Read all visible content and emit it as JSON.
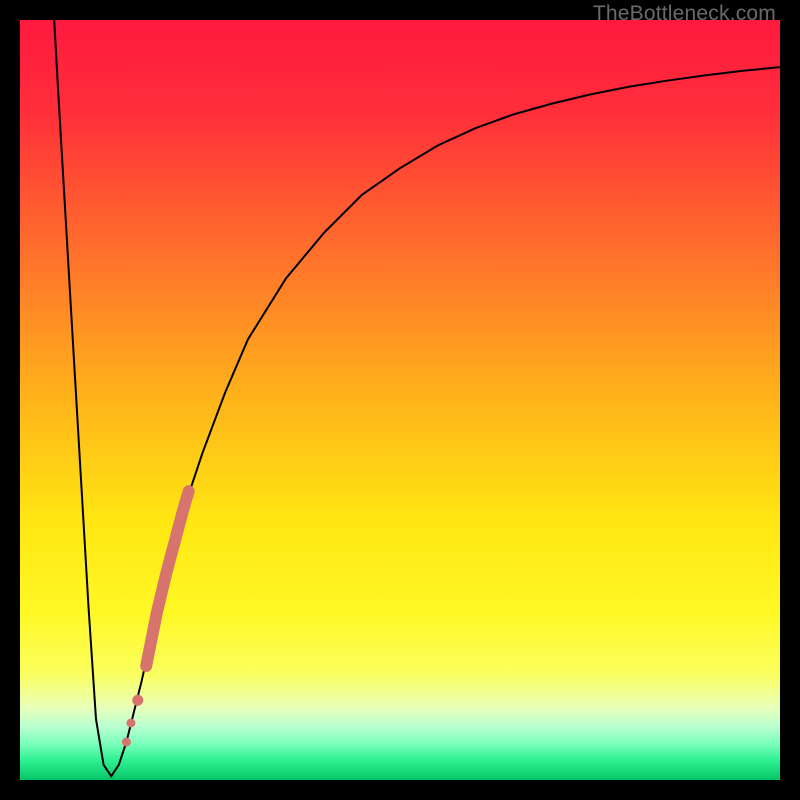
{
  "watermark": "TheBottleneck.com",
  "chart_data": {
    "type": "line",
    "title": "",
    "xlabel": "",
    "ylabel": "",
    "xlim": [
      0,
      100
    ],
    "ylim": [
      0,
      100
    ],
    "grid": false,
    "legend": false,
    "background_gradient": {
      "stops": [
        {
          "pos": 0.0,
          "color": "#ff1a3f"
        },
        {
          "pos": 0.12,
          "color": "#ff2e3a"
        },
        {
          "pos": 0.3,
          "color": "#ff6e2c"
        },
        {
          "pos": 0.5,
          "color": "#ffb41a"
        },
        {
          "pos": 0.66,
          "color": "#ffe712"
        },
        {
          "pos": 0.78,
          "color": "#fff825"
        },
        {
          "pos": 0.86,
          "color": "#fbff5f"
        },
        {
          "pos": 0.905,
          "color": "#e8ffb9"
        },
        {
          "pos": 0.93,
          "color": "#b8ffd0"
        },
        {
          "pos": 0.952,
          "color": "#7affba"
        },
        {
          "pos": 0.975,
          "color": "#2cf08f"
        },
        {
          "pos": 1.0,
          "color": "#07c567"
        }
      ]
    },
    "series": [
      {
        "name": "bottleneck-curve",
        "color": "#000000",
        "stroke_width": 2,
        "x": [
          4.5,
          5,
          6,
          7,
          8,
          9,
          10,
          11,
          12,
          13,
          14,
          15,
          16,
          18,
          20,
          22,
          24,
          27,
          30,
          35,
          40,
          45,
          50,
          55,
          60,
          65,
          70,
          75,
          80,
          85,
          90,
          95,
          100
        ],
        "y": [
          100,
          91,
          74,
          57,
          40,
          23,
          8,
          2,
          0.5,
          2,
          5,
          9,
          13,
          22,
          30,
          37,
          43,
          51,
          58,
          66,
          72,
          77,
          80.5,
          83.5,
          85.8,
          87.6,
          89,
          90.2,
          91.2,
          92,
          92.7,
          93.3,
          93.8
        ]
      }
    ],
    "highlight_segment": {
      "name": "highlight-dots",
      "color": "#d6746d",
      "radius": 6,
      "points": [
        {
          "x": 14.0,
          "y": 5.0
        },
        {
          "x": 14.6,
          "y": 7.5
        },
        {
          "x": 15.5,
          "y": 10.5
        },
        {
          "x": 16.6,
          "y": 15.0
        },
        {
          "x": 17.0,
          "y": 17.0
        },
        {
          "x": 17.5,
          "y": 19.5
        },
        {
          "x": 18.0,
          "y": 22.0
        },
        {
          "x": 18.6,
          "y": 24.5
        },
        {
          "x": 19.2,
          "y": 27.0
        },
        {
          "x": 19.8,
          "y": 29.3
        },
        {
          "x": 20.4,
          "y": 31.5
        },
        {
          "x": 21.0,
          "y": 33.8
        },
        {
          "x": 21.6,
          "y": 36.0
        },
        {
          "x": 22.2,
          "y": 38.0
        }
      ]
    }
  }
}
